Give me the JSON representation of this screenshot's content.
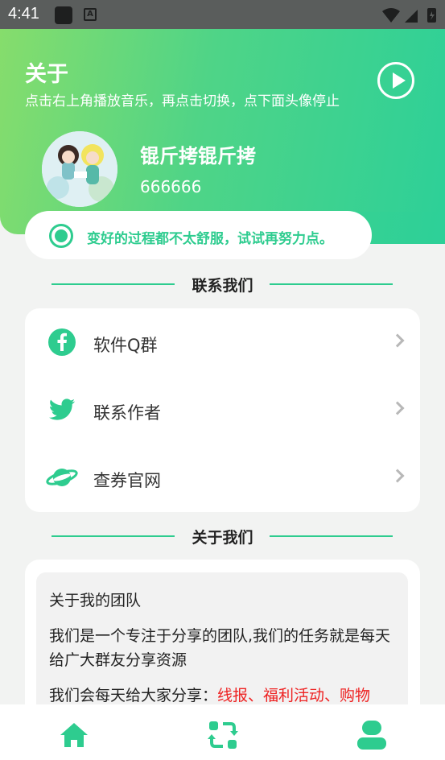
{
  "status_bar": {
    "time": "4:41"
  },
  "header": {
    "title": "关于",
    "subtitle": "点击右上角播放音乐，再点击切换，点下面头像停止"
  },
  "profile": {
    "name": "锟斤拷锟斤拷",
    "id": "666666"
  },
  "motto": "变好的过程都不太舒服，试试再努力点。",
  "contact_section": {
    "title": "联系我们",
    "items": [
      {
        "label": "软件Q群",
        "icon": "facebook-icon"
      },
      {
        "label": "联系作者",
        "icon": "twitter-icon"
      },
      {
        "label": "查券官网",
        "icon": "planet-icon"
      }
    ]
  },
  "about_section": {
    "title": "关于我们",
    "heading": "关于我的团队",
    "paragraph": "我们是一个专注于分享的团队,我们的任务就是每天给广大群友分享资源",
    "partial_line_prefix": "我们会每天给大家分享：",
    "partial_line_highlight": "线报、福利活动、购物"
  },
  "bottom_nav": [
    "home-icon",
    "sync-icon",
    "profile-icon"
  ],
  "colors": {
    "accent": "#2ecc8f",
    "highlight": "#ee2222"
  }
}
